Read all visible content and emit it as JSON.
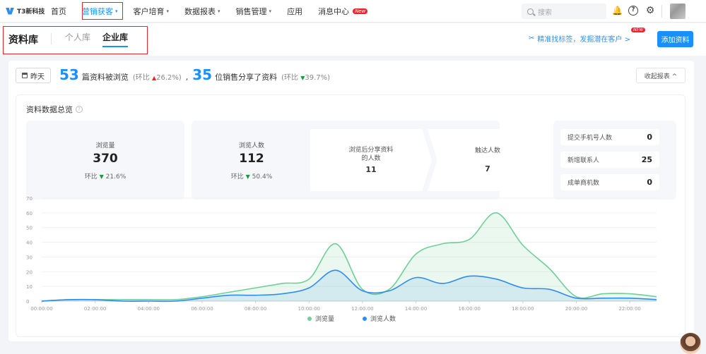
{
  "brand": {
    "name": "T3新科技"
  },
  "nav": {
    "items": [
      {
        "label": "首页",
        "chevron": false
      },
      {
        "label": "营销获客",
        "chevron": true
      },
      {
        "label": "客户培育",
        "chevron": true
      },
      {
        "label": "数据报表",
        "chevron": true
      },
      {
        "label": "销售管理",
        "chevron": true
      },
      {
        "label": "应用",
        "chevron": false
      },
      {
        "label": "消息中心",
        "chevron": false,
        "badge": "New"
      }
    ]
  },
  "search": {
    "placeholder": "搜索"
  },
  "toolbar": {
    "bell": "🔔",
    "help": "?",
    "settings": "⚙"
  },
  "library": {
    "title": "资料库",
    "tabs": [
      {
        "label": "个人库"
      },
      {
        "label": "企业库"
      }
    ],
    "promo_text": "精准找标签，发掘潜在客户 >",
    "promo_badge": "NEW",
    "add_button": "添加资料"
  },
  "summary": {
    "date_button": "昨天",
    "viewed_count": "53",
    "viewed_label": "篇资料被浏览",
    "viewed_ratio_label": "(环比",
    "viewed_ratio": "26.2%)",
    "shared_count": "35",
    "shared_label": "位销售分享了资料",
    "shared_ratio_label": "(环比",
    "shared_ratio": "39.7%)",
    "collapse_button": "收起报表 ^"
  },
  "overview": {
    "title": "资料数据总览",
    "views": {
      "label": "浏览量",
      "value": "370",
      "ratio_label": "环比",
      "ratio": "21.6%"
    },
    "visitors": {
      "label": "浏览人数",
      "value": "112",
      "ratio_label": "环比",
      "ratio": "50.4%"
    },
    "funnel_shared": {
      "label_line1": "浏览后分享资料",
      "label_line2": "的人数",
      "value": "11"
    },
    "funnel_reach": {
      "label": "触达人数",
      "value": "7"
    },
    "side": [
      {
        "label": "提交手机号人数",
        "value": "0"
      },
      {
        "label": "新增联系人",
        "value": "25"
      },
      {
        "label": "成单商机数",
        "value": "0"
      }
    ]
  },
  "colors": {
    "views": "#6fcf97",
    "visitors": "#2f8cf0",
    "accent": "#1890ff",
    "highlight": "#e8262b"
  },
  "chart_data": {
    "type": "line",
    "x": [
      "00:00",
      "01:00",
      "02:00",
      "03:00",
      "04:00",
      "05:00",
      "06:00",
      "07:00",
      "08:00",
      "09:00",
      "10:00",
      "11:00",
      "12:00",
      "13:00",
      "14:00",
      "15:00",
      "16:00",
      "17:00",
      "18:00",
      "19:00",
      "20:00",
      "21:00",
      "22:00",
      "23:00"
    ],
    "x_tick_labels": [
      "00:00:00",
      "02:00:00",
      "04:00:00",
      "06:00:00",
      "08:00:00",
      "10:00:00",
      "12:00:00",
      "14:00:00",
      "16:00:00",
      "18:00:00",
      "20:00:00",
      "22:00:00"
    ],
    "ylim": [
      0,
      70
    ],
    "y_ticks": [
      "0",
      "10",
      "20",
      "30",
      "40",
      "50",
      "60",
      "70"
    ],
    "series": [
      {
        "name": "浏览量",
        "values": [
          0,
          1,
          1,
          1,
          1,
          1,
          3,
          6,
          9,
          12,
          15,
          39,
          8,
          8,
          32,
          39,
          42,
          60,
          38,
          22,
          3,
          5,
          5,
          3
        ]
      },
      {
        "name": "浏览人数",
        "values": [
          0,
          1,
          1,
          0,
          0,
          0,
          2,
          4,
          4,
          5,
          9,
          21,
          7,
          7,
          16,
          12,
          17,
          15,
          9,
          8,
          2,
          2,
          2,
          1
        ]
      }
    ],
    "legend_position": "bottom"
  }
}
